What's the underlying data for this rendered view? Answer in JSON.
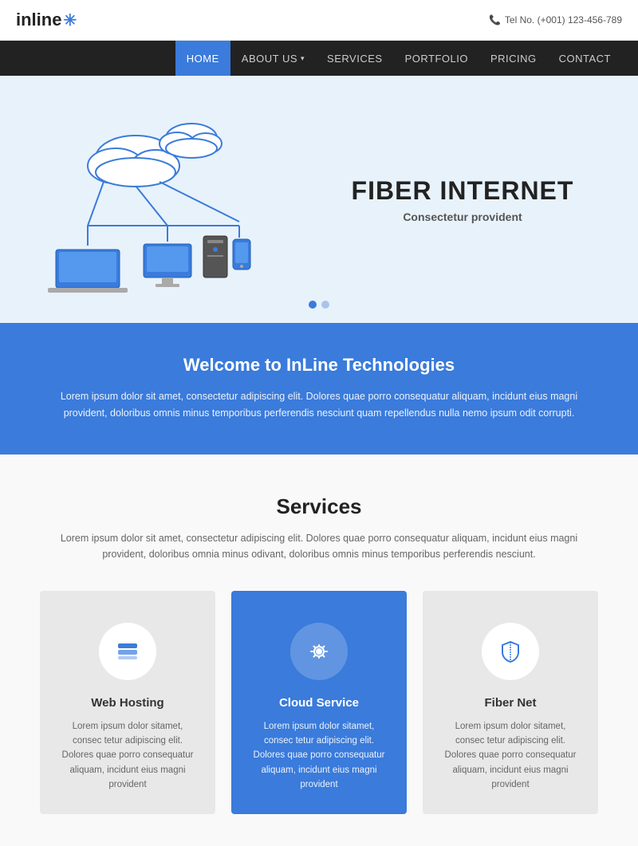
{
  "header": {
    "logo_text": "inline",
    "logo_star": "✳",
    "phone_icon": "📞",
    "phone_label": "Tel No. (+001) 123-456-789"
  },
  "nav": {
    "items": [
      {
        "label": "HOME",
        "active": true,
        "has_arrow": false
      },
      {
        "label": "ABOUT US",
        "active": false,
        "has_arrow": true
      },
      {
        "label": "SERVICES",
        "active": false,
        "has_arrow": false
      },
      {
        "label": "PORTFOLIO",
        "active": false,
        "has_arrow": false
      },
      {
        "label": "PRICING",
        "active": false,
        "has_arrow": false
      },
      {
        "label": "CONTACT",
        "active": false,
        "has_arrow": false
      }
    ]
  },
  "hero": {
    "title": "FIBER INTERNET",
    "subtitle": "Consectetur provident",
    "dots": [
      {
        "active": true
      },
      {
        "active": false
      }
    ]
  },
  "welcome": {
    "title": "Welcome to InLine Technologies",
    "text": "Lorem ipsum dolor sit amet, consectetur adipiscing elit. Dolores quae porro consequatur aliquam, incidunt eius magni provident, doloribus omnis minus temporibus perferendis nesciunt quam repellendus nulla nemo ipsum odit corrupti."
  },
  "services": {
    "title": "Services",
    "description": "Lorem ipsum dolor sit amet, consectetur adipiscing elit. Dolores quae porro consequatur aliquam, incidunt eius magni provident, doloribus omnia minus odivant, doloribus omnis minus temporibus perferendis nesciunt.",
    "cards": [
      {
        "name": "Web Hosting",
        "icon": "layers",
        "text": "Lorem ipsum dolor sitamet, consec tetur adipiscing elit. Dolores quae porro consequatur aliquam, incidunt eius magni provident",
        "featured": false
      },
      {
        "name": "Cloud Service",
        "icon": "gear",
        "text": "Lorem ipsum dolor sitamet, consec tetur adipiscing elit. Dolores quae porro consequatur aliquam, incidunt eius magni provident",
        "featured": true
      },
      {
        "name": "Fiber Net",
        "icon": "shield",
        "text": "Lorem ipsum dolor sitamet, consec tetur adipiscing elit. Dolores quae porro consequatur aliquam, incidunt eius magni provident",
        "featured": false
      }
    ]
  }
}
